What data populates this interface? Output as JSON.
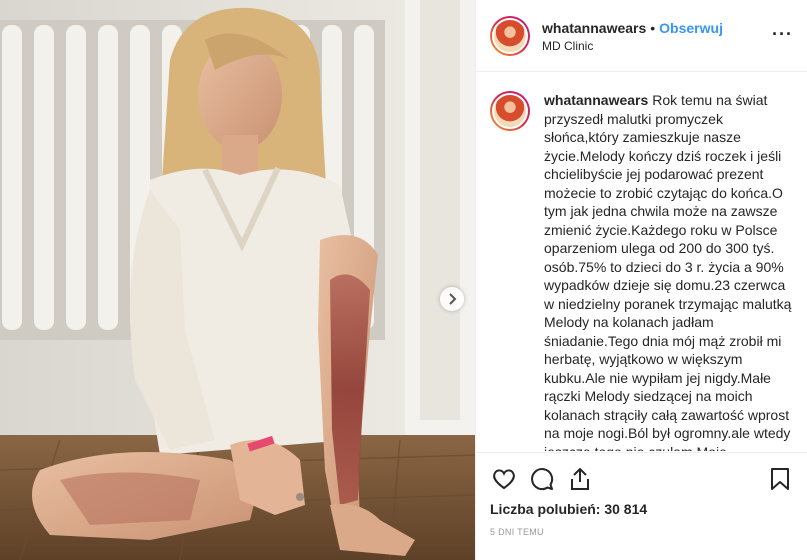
{
  "post": {
    "username": "whatannawears",
    "separator": "•",
    "follow_label": "Obserwuj",
    "location": "MD Clinic",
    "more_label": "···",
    "caption_text": "Rok temu na świat przyszedł malutki promyczek słońca,który zamieszkuje nasze życie.Melody kończy dziś roczek i jeśli chcielibyście jej podarować prezent możecie to zrobić czytając do końca.O tym jak jedna chwila może na zawsze zmienić życie.Każdego roku w Polsce oparzeniom ulega od 200 do 300 tyś. osób.75% to dzieci do 3 r. życia a 90% wypadków dzieje się domu.23 czerwca w niedzielny poranek trzymając malutką Melody na kolanach jadłam śniadanie.Tego dnia mój mąż zrobił mi herbatę, wyjątkowo w większym kubku.Ale nie wypiłam jej nigdy.Małe rączki Melody siedzącej na moich kolanach strąciły całą zawartość wprost na moje nogi.Ból był ogromny.ale wtedy jeszcze tego nie czułam.Moje",
    "likes_label": "Liczba polubień:",
    "likes_count": "30 814",
    "timestamp": "5 DNI TEMU"
  },
  "icons": {
    "like": "heart-icon",
    "comment": "comment-icon",
    "share": "share-icon",
    "save": "bookmark-icon",
    "next": "chevron-right-icon"
  },
  "colors": {
    "follow": "#3897f0",
    "text": "#262626",
    "muted": "#999999",
    "border": "#efefef"
  }
}
